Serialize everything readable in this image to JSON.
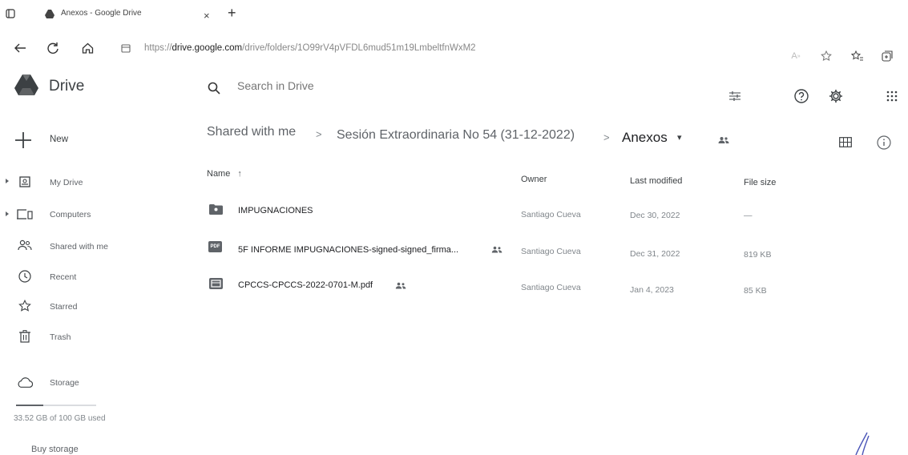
{
  "browser": {
    "tab_title": "Anexos - Google Drive",
    "tab_close": "×",
    "new_tab": "+",
    "url_prefix": "https://",
    "url_domain": "drive.google.com",
    "url_path": "/drive/folders/1O99rV4pVFDL6mud51m19LmbeltfnWxM2"
  },
  "app": {
    "name": "Drive"
  },
  "search": {
    "placeholder": "Search in Drive"
  },
  "breadcrumb": {
    "items": [
      "Shared with me",
      "Sesión Extraordinaria No 54 (31-12-2022)",
      "Anexos"
    ],
    "separator": ">",
    "dropdown": "▾"
  },
  "sidebar": {
    "new_label": "New",
    "items": [
      {
        "label": "My Drive",
        "icon": "my-drive-icon"
      },
      {
        "label": "Computers",
        "icon": "computers-icon"
      },
      {
        "label": "Shared with me",
        "icon": "shared-icon"
      },
      {
        "label": "Recent",
        "icon": "clock-icon"
      },
      {
        "label": "Starred",
        "icon": "star-icon"
      },
      {
        "label": "Trash",
        "icon": "trash-icon"
      }
    ],
    "storage_label": "Storage",
    "storage_used_text": "33.52 GB of 100 GB used",
    "storage_fraction": 0.3352,
    "buy_storage": "Buy storage"
  },
  "table": {
    "columns": {
      "name": "Name",
      "sort": "↑",
      "owner": "Owner",
      "modified": "Last modified",
      "size": "File size"
    },
    "rows": [
      {
        "name": "IMPUGNACIONES",
        "type": "folder",
        "owner": "Santiago Cueva",
        "modified": "Dec 30, 2022",
        "size": "—",
        "shared": false
      },
      {
        "name": "5F INFORME IMPUGNACIONES-signed-signed_firma...",
        "type": "pdf",
        "owner": "Santiago Cueva",
        "modified": "Dec 31, 2022",
        "size": "819 KB",
        "shared": true
      },
      {
        "name": "CPCCS-CPCCS-2022-0701-M.pdf",
        "type": "doc",
        "owner": "Santiago Cueva",
        "modified": "Jan 4, 2023",
        "size": "85 KB",
        "shared": true
      }
    ]
  },
  "colors": {
    "icon": "#5f6368",
    "text": "#202124",
    "muted": "#80868b"
  }
}
